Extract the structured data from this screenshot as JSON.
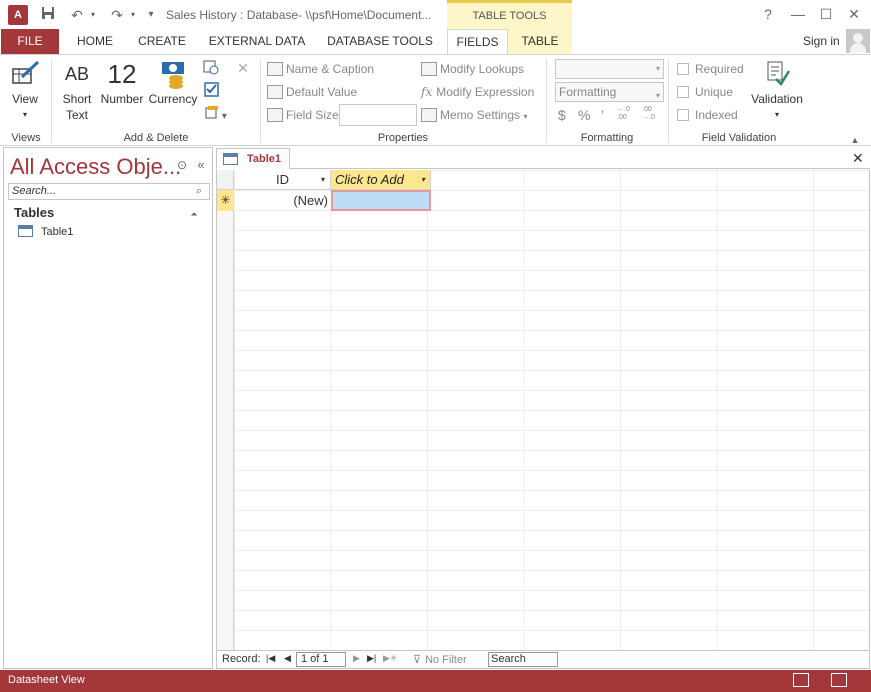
{
  "titlebar": {
    "app_icon": "A",
    "title": "Sales History : Database- \\\\psf\\Home\\Document...",
    "contextual_group": "TABLE TOOLS",
    "help": "?",
    "minimize": "—",
    "restore": "☐",
    "close": "✕"
  },
  "tabs": {
    "file": "FILE",
    "home": "HOME",
    "create": "CREATE",
    "external_data": "EXTERNAL DATA",
    "database_tools": "DATABASE TOOLS",
    "fields": "FIELDS",
    "table": "TABLE",
    "sign_in": "Sign in"
  },
  "ribbon": {
    "views": {
      "view_label": "View",
      "group_label": "Views"
    },
    "add_delete": {
      "short_text_icon": "AB",
      "short_text_label": "Short Text",
      "number_icon": "12",
      "number_label": "Number",
      "currency_label": "Currency",
      "group_label": "Add & Delete"
    },
    "properties": {
      "name_caption": "Name & Caption",
      "default_value": "Default Value",
      "field_size": "Field Size",
      "modify_lookups": "Modify Lookups",
      "modify_expression": "Modify Expression",
      "memo_settings": "Memo Settings",
      "group_label": "Properties"
    },
    "formatting": {
      "format_value": "Formatting",
      "currency_sym": "$",
      "percent_sym": "%",
      "comma_sym": "’",
      "inc_decimals": "←.0 .00",
      "dec_decimals": ".00 →.0",
      "group_label": "Formatting"
    },
    "validation": {
      "required": "Required",
      "unique": "Unique",
      "indexed": "Indexed",
      "validation_label": "Validation",
      "group_label": "Field Validation"
    }
  },
  "nav_pane": {
    "title": "All Access Obje...",
    "search_placeholder": "Search...",
    "section": "Tables",
    "items": [
      {
        "label": "Table1"
      }
    ]
  },
  "document": {
    "tab_label": "Table1",
    "columns": [
      "ID",
      "Click to Add"
    ],
    "new_row_marker": "✳",
    "new_row_value": "(New)"
  },
  "record_nav": {
    "label": "Record:",
    "position": "1 of 1",
    "no_filter": "No Filter",
    "search": "Search"
  },
  "statusbar": {
    "text": "Datasheet View"
  },
  "colors": {
    "accent": "#a4373a",
    "contextual": "#fdf6c9",
    "selected_cell": "#bfdcf7"
  }
}
